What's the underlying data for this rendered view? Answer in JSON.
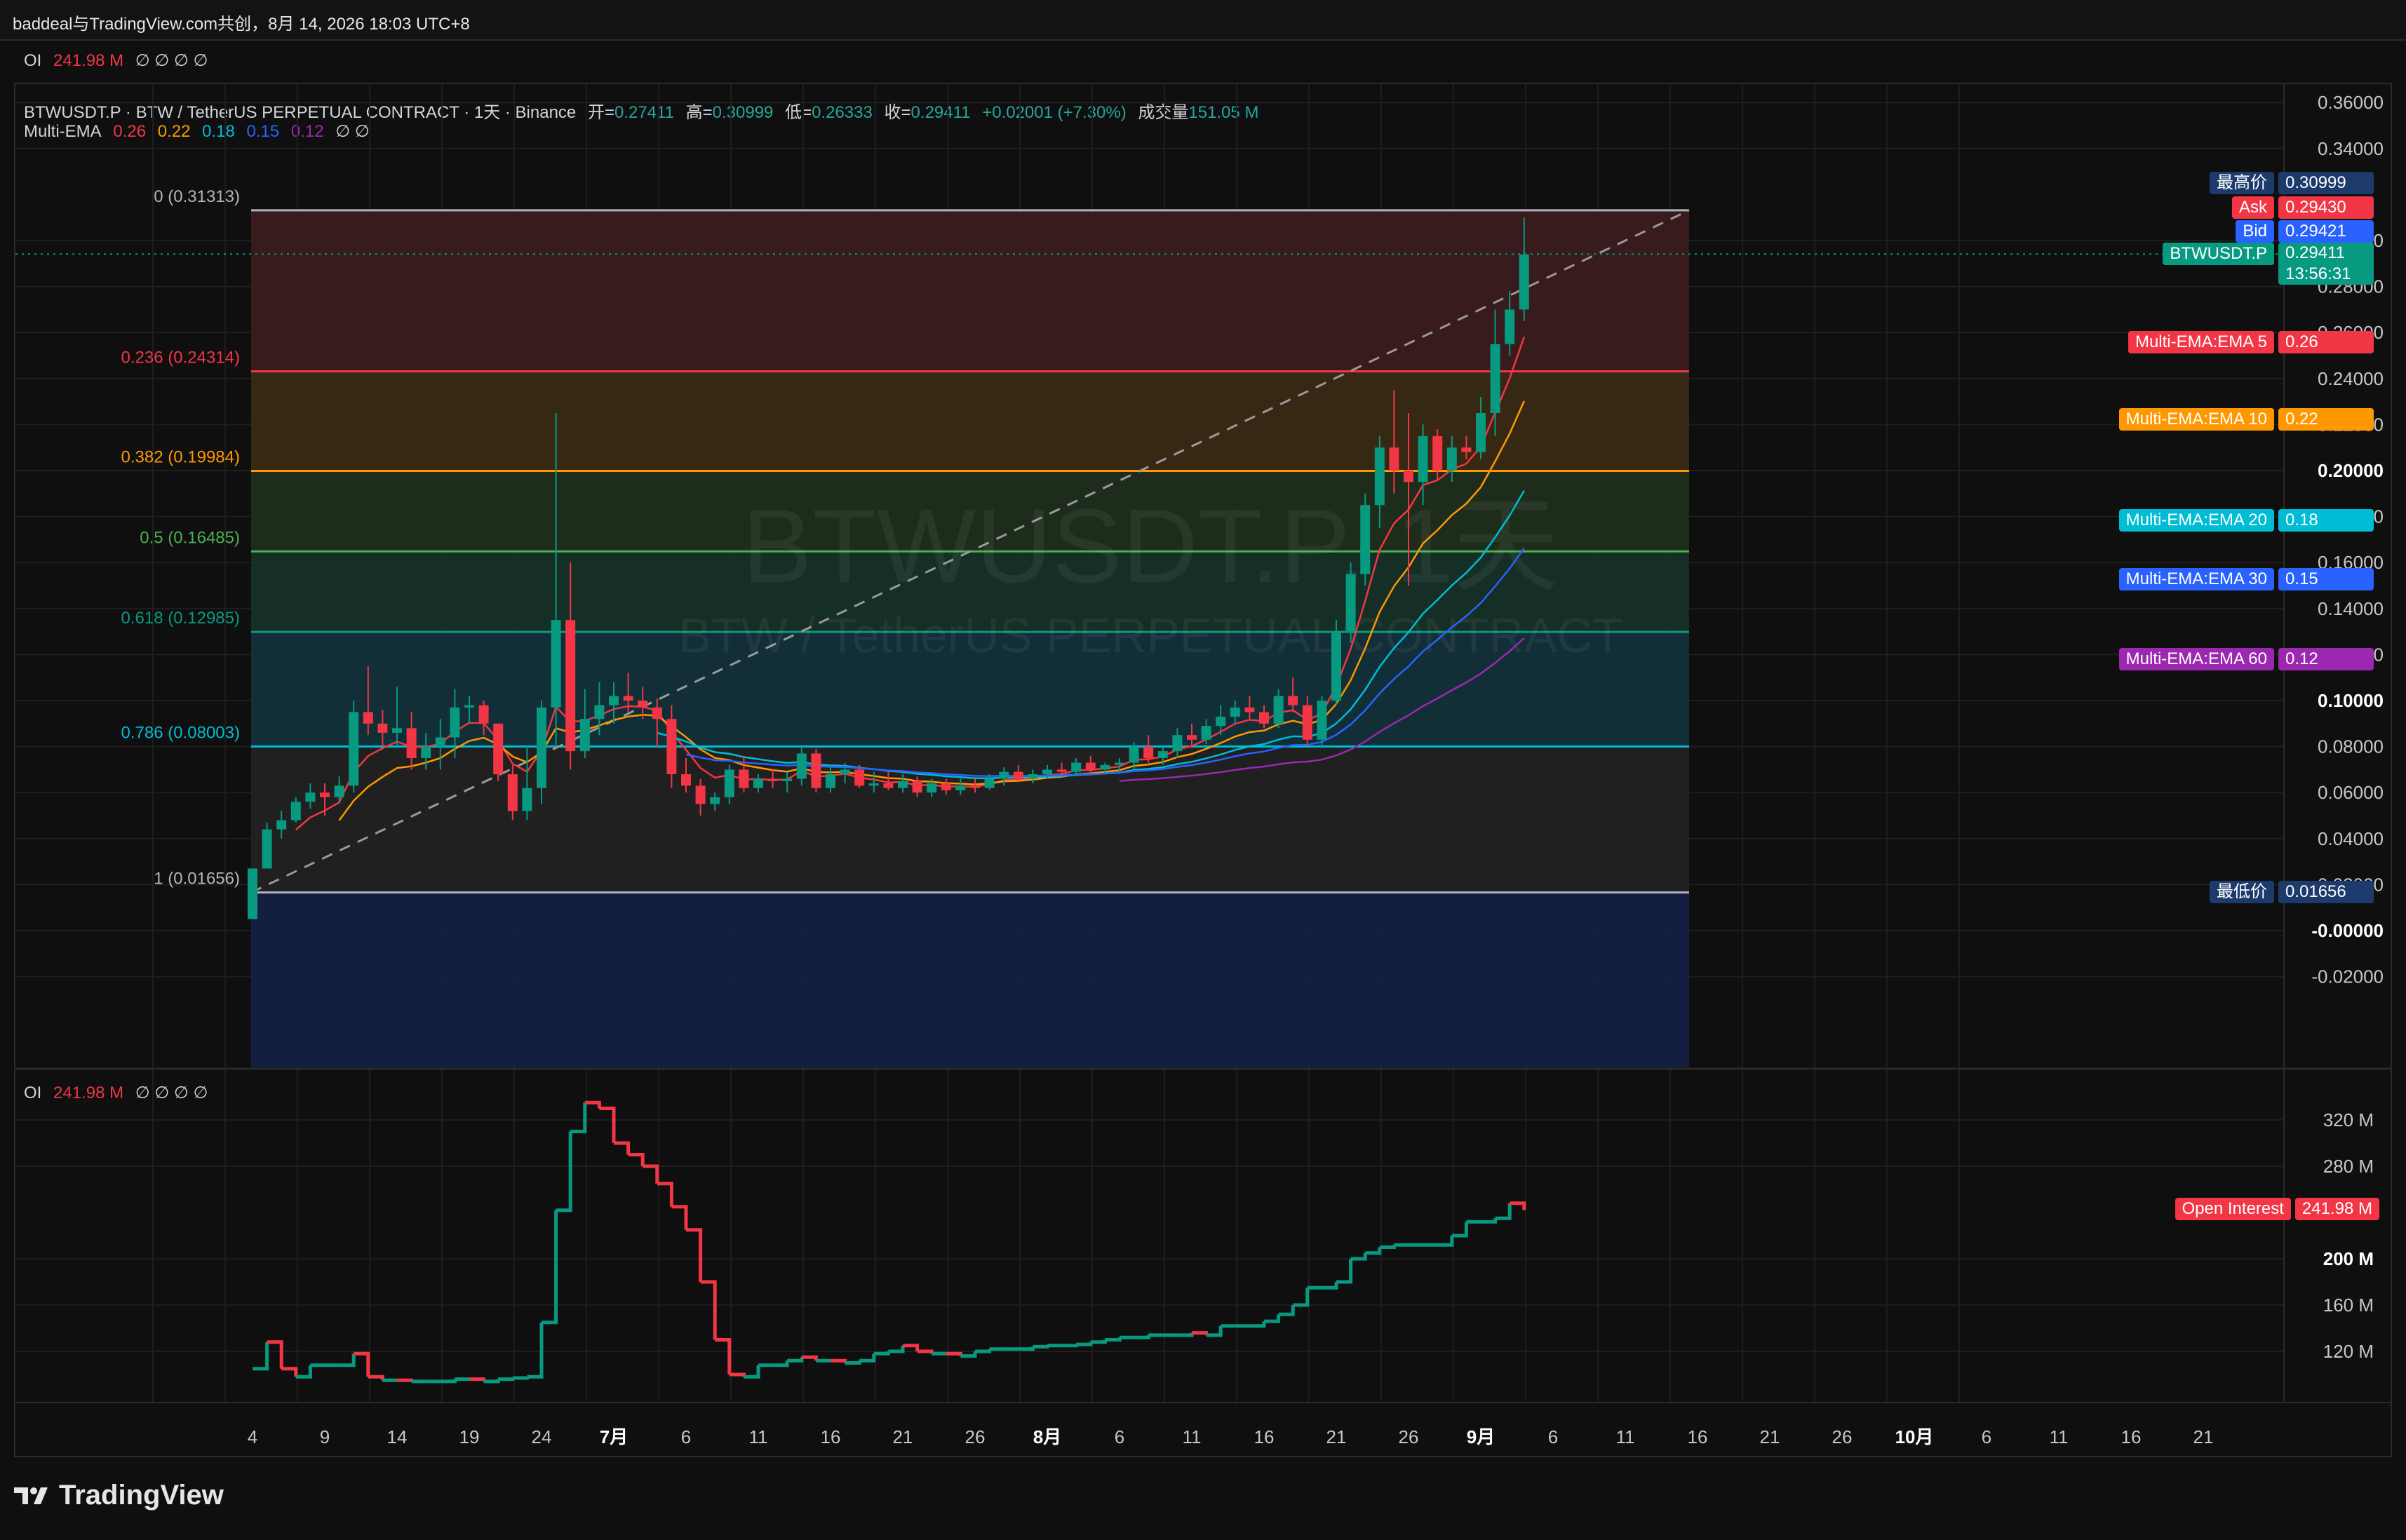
{
  "header": {
    "text": "baddeal与TradingView.com共创，8月 14, 2026 18:03 UTC+8"
  },
  "oi_indicator": {
    "label": "OI",
    "value": "241.98 M",
    "extras": "∅ ∅ ∅ ∅"
  },
  "symbol_legend": {
    "title": "BTWUSDT.P · BTW / TetherUS PERPETUAL CONTRACT · 1天 · Binance",
    "open_label": "开=",
    "open": "0.27411",
    "high_label": "高=",
    "high": "0.30999",
    "low_label": "低=",
    "low": "0.26333",
    "close_label": "收=",
    "close": "0.29411",
    "change": "+0.02001 (+7.30%)",
    "volume_label": "成交量",
    "volume": "151.05 M"
  },
  "ema_legend": {
    "label": "Multi-EMA",
    "values": [
      "0.26",
      "0.22",
      "0.18",
      "0.15",
      "0.12"
    ],
    "colors": [
      "#f23645",
      "#ff9800",
      "#00bcd4",
      "#2962ff",
      "#9c27b0"
    ],
    "extras": "∅ ∅"
  },
  "watermark": {
    "symbol": "BTWUSDT.P, 1天",
    "name": "BTW / TetherUS PERPETUAL CONTRACT"
  },
  "fib_levels": [
    {
      "level": "0 (0.31313)",
      "price": 0.31313,
      "color": "#b2b5be",
      "fill": "#3a1c1f"
    },
    {
      "level": "0.236 (0.24314)",
      "price": 0.24314,
      "color": "#f23645",
      "fill": "#3a2a14"
    },
    {
      "level": "0.382 (0.19984)",
      "price": 0.19984,
      "color": "#ff9800",
      "fill": "#1f2e1c"
    },
    {
      "level": "0.5 (0.16485)",
      "price": 0.16485,
      "color": "#4caf50",
      "fill": "#163028"
    },
    {
      "level": "0.618 (0.12985)",
      "price": 0.12985,
      "color": "#089981",
      "fill": "#13303a"
    },
    {
      "level": "0.786 (0.08003)",
      "price": 0.08003,
      "color": "#00bcd4",
      "fill": "#222222"
    },
    {
      "level": "1 (0.01656)",
      "price": 0.01656,
      "color": "#b2b5be",
      "fill": "#152044"
    }
  ],
  "price_axis": {
    "ticks": [
      "0.36000",
      "0.34000",
      "0.30000",
      "0.28000",
      "0.26000",
      "0.24000",
      "0.22000",
      "0.20000",
      "0.18000",
      "0.16000",
      "0.14000",
      "0.12000",
      "0.10000",
      "0.08000",
      "0.06000",
      "0.04000",
      "0.02000",
      "-0.00000",
      "-0.02000"
    ],
    "bold_ticks": [
      "0.20000",
      "0.10000",
      "-0.00000"
    ]
  },
  "price_tags": [
    {
      "label": "最高价",
      "value": "0.30999",
      "color": "#1c3a6b"
    },
    {
      "label": "Ask",
      "value": "0.29430",
      "color": "#f23645"
    },
    {
      "label": "Bid",
      "value": "0.29421",
      "color": "#2962ff"
    },
    {
      "label": "BTWUSDT.P",
      "value": "0.29411",
      "sub": "13:56:31",
      "color": "#089981"
    },
    {
      "label": "Multi-EMA:EMA 5",
      "value": "0.26",
      "color": "#f23645"
    },
    {
      "label": "Multi-EMA:EMA 10",
      "value": "0.22",
      "color": "#ff9800"
    },
    {
      "label": "Multi-EMA:EMA 20",
      "value": "0.18",
      "color": "#00bcd4"
    },
    {
      "label": "Multi-EMA:EMA 30",
      "value": "0.15",
      "color": "#2962ff"
    },
    {
      "label": "Multi-EMA:EMA 60",
      "value": "0.12",
      "color": "#9c27b0"
    },
    {
      "label": "最低价",
      "value": "0.01656",
      "color": "#1c3a6b"
    }
  ],
  "oi_axis": {
    "ticks": [
      "320 M",
      "280 M",
      "200 M",
      "160 M",
      "120 M"
    ],
    "bold_ticks": [
      "200 M"
    ]
  },
  "oi_tag": {
    "label": "Open Interest",
    "value": "241.98 M",
    "color": "#f23645"
  },
  "time_axis": {
    "ticks": [
      "4",
      "9",
      "14",
      "19",
      "24",
      "7月",
      "6",
      "11",
      "16",
      "21",
      "26",
      "8月",
      "6",
      "11",
      "16",
      "21",
      "26",
      "9月",
      "6",
      "11",
      "16",
      "21",
      "26",
      "10月",
      "6",
      "11",
      "16",
      "21"
    ],
    "bold_ticks": [
      "7月",
      "8月",
      "9月",
      "10月"
    ]
  },
  "chart_data": {
    "type": "candlestick",
    "title": "BTWUSDT.P · BTW / TetherUS PERPETUAL CONTRACT · 1天 · Binance",
    "ylim": [
      -0.03,
      0.37
    ],
    "x_range_days": [
      0,
      202
    ],
    "candles": [
      [
        0,
        0.005,
        0.027,
        0.005,
        0.027
      ],
      [
        1,
        0.027,
        0.047,
        0.027,
        0.044
      ],
      [
        2,
        0.044,
        0.052,
        0.04,
        0.048
      ],
      [
        3,
        0.048,
        0.058,
        0.047,
        0.056
      ],
      [
        4,
        0.056,
        0.064,
        0.053,
        0.06
      ],
      [
        5,
        0.06,
        0.064,
        0.05,
        0.058
      ],
      [
        6,
        0.058,
        0.067,
        0.056,
        0.063
      ],
      [
        7,
        0.063,
        0.1,
        0.06,
        0.095
      ],
      [
        8,
        0.095,
        0.115,
        0.085,
        0.09
      ],
      [
        9,
        0.09,
        0.096,
        0.08,
        0.086
      ],
      [
        10,
        0.086,
        0.106,
        0.08,
        0.088
      ],
      [
        11,
        0.088,
        0.095,
        0.07,
        0.075
      ],
      [
        12,
        0.075,
        0.086,
        0.07,
        0.08
      ],
      [
        13,
        0.08,
        0.092,
        0.07,
        0.084
      ],
      [
        14,
        0.084,
        0.105,
        0.075,
        0.097
      ],
      [
        15,
        0.097,
        0.102,
        0.09,
        0.098
      ],
      [
        16,
        0.098,
        0.1,
        0.085,
        0.09
      ],
      [
        17,
        0.09,
        0.09,
        0.065,
        0.068
      ],
      [
        18,
        0.068,
        0.072,
        0.048,
        0.052
      ],
      [
        19,
        0.052,
        0.08,
        0.048,
        0.062
      ],
      [
        20,
        0.062,
        0.1,
        0.055,
        0.097
      ],
      [
        21,
        0.097,
        0.225,
        0.08,
        0.135
      ],
      [
        22,
        0.135,
        0.16,
        0.07,
        0.078
      ],
      [
        23,
        0.078,
        0.105,
        0.075,
        0.092
      ],
      [
        24,
        0.092,
        0.108,
        0.085,
        0.098
      ],
      [
        25,
        0.098,
        0.108,
        0.09,
        0.102
      ],
      [
        26,
        0.102,
        0.112,
        0.095,
        0.1
      ],
      [
        27,
        0.1,
        0.106,
        0.092,
        0.097
      ],
      [
        28,
        0.097,
        0.101,
        0.08,
        0.092
      ],
      [
        29,
        0.092,
        0.098,
        0.062,
        0.068
      ],
      [
        30,
        0.068,
        0.075,
        0.06,
        0.063
      ],
      [
        31,
        0.063,
        0.066,
        0.05,
        0.055
      ],
      [
        32,
        0.055,
        0.06,
        0.052,
        0.058
      ],
      [
        33,
        0.058,
        0.072,
        0.055,
        0.07
      ],
      [
        34,
        0.07,
        0.076,
        0.06,
        0.062
      ],
      [
        35,
        0.062,
        0.068,
        0.06,
        0.066
      ],
      [
        36,
        0.066,
        0.07,
        0.062,
        0.065
      ],
      [
        37,
        0.065,
        0.069,
        0.06,
        0.066
      ],
      [
        38,
        0.066,
        0.08,
        0.063,
        0.077
      ],
      [
        39,
        0.077,
        0.079,
        0.06,
        0.062
      ],
      [
        40,
        0.062,
        0.072,
        0.06,
        0.068
      ],
      [
        41,
        0.068,
        0.073,
        0.064,
        0.07
      ],
      [
        42,
        0.07,
        0.072,
        0.062,
        0.063
      ],
      [
        43,
        0.063,
        0.069,
        0.06,
        0.064
      ],
      [
        44,
        0.064,
        0.069,
        0.061,
        0.062
      ],
      [
        45,
        0.062,
        0.068,
        0.06,
        0.065
      ],
      [
        46,
        0.065,
        0.067,
        0.058,
        0.06
      ],
      [
        47,
        0.06,
        0.066,
        0.058,
        0.064
      ],
      [
        48,
        0.064,
        0.066,
        0.059,
        0.061
      ],
      [
        49,
        0.061,
        0.066,
        0.059,
        0.063
      ],
      [
        50,
        0.063,
        0.066,
        0.06,
        0.062
      ],
      [
        51,
        0.062,
        0.068,
        0.061,
        0.066
      ],
      [
        52,
        0.066,
        0.071,
        0.063,
        0.069
      ],
      [
        53,
        0.069,
        0.072,
        0.065,
        0.066
      ],
      [
        54,
        0.066,
        0.07,
        0.064,
        0.068
      ],
      [
        55,
        0.068,
        0.072,
        0.066,
        0.07
      ],
      [
        56,
        0.07,
        0.073,
        0.067,
        0.069
      ],
      [
        57,
        0.069,
        0.075,
        0.067,
        0.073
      ],
      [
        58,
        0.073,
        0.076,
        0.068,
        0.07
      ],
      [
        59,
        0.07,
        0.073,
        0.068,
        0.072
      ],
      [
        60,
        0.072,
        0.075,
        0.069,
        0.073
      ],
      [
        61,
        0.073,
        0.082,
        0.07,
        0.08
      ],
      [
        62,
        0.08,
        0.085,
        0.073,
        0.075
      ],
      [
        63,
        0.075,
        0.08,
        0.072,
        0.078
      ],
      [
        64,
        0.078,
        0.088,
        0.075,
        0.085
      ],
      [
        65,
        0.085,
        0.09,
        0.08,
        0.083
      ],
      [
        66,
        0.083,
        0.092,
        0.081,
        0.089
      ],
      [
        67,
        0.089,
        0.098,
        0.085,
        0.093
      ],
      [
        68,
        0.093,
        0.1,
        0.09,
        0.097
      ],
      [
        69,
        0.097,
        0.102,
        0.092,
        0.095
      ],
      [
        70,
        0.095,
        0.098,
        0.088,
        0.09
      ],
      [
        71,
        0.09,
        0.105,
        0.088,
        0.102
      ],
      [
        72,
        0.102,
        0.11,
        0.095,
        0.098
      ],
      [
        73,
        0.098,
        0.102,
        0.08,
        0.083
      ],
      [
        74,
        0.083,
        0.102,
        0.08,
        0.1
      ],
      [
        75,
        0.1,
        0.135,
        0.098,
        0.13
      ],
      [
        76,
        0.13,
        0.16,
        0.125,
        0.155
      ],
      [
        77,
        0.155,
        0.19,
        0.15,
        0.185
      ],
      [
        78,
        0.185,
        0.215,
        0.175,
        0.21
      ],
      [
        79,
        0.21,
        0.235,
        0.19,
        0.2
      ],
      [
        80,
        0.2,
        0.225,
        0.15,
        0.195
      ],
      [
        81,
        0.195,
        0.22,
        0.185,
        0.215
      ],
      [
        82,
        0.215,
        0.218,
        0.196,
        0.2
      ],
      [
        83,
        0.2,
        0.215,
        0.195,
        0.21
      ],
      [
        84,
        0.21,
        0.215,
        0.205,
        0.208
      ],
      [
        85,
        0.208,
        0.232,
        0.205,
        0.225
      ],
      [
        86,
        0.225,
        0.27,
        0.215,
        0.255
      ],
      [
        87,
        0.255,
        0.278,
        0.25,
        0.27
      ],
      [
        88,
        0.27,
        0.31,
        0.265,
        0.294
      ]
    ],
    "ema": [
      {
        "name": "EMA 5",
        "color": "#f23645",
        "start": 3,
        "end_value": 0.26
      },
      {
        "name": "EMA 10",
        "color": "#ff9800",
        "start": 6,
        "end_value": 0.22
      },
      {
        "name": "EMA 20",
        "color": "#00bcd4",
        "start": 28,
        "end_value": 0.18
      },
      {
        "name": "EMA 30",
        "color": "#2962ff",
        "start": 30,
        "end_value": 0.15
      },
      {
        "name": "EMA 60",
        "color": "#9c27b0",
        "start": 60,
        "end_value": 0.12
      }
    ],
    "open_interest": {
      "unit": "M",
      "ylim": [
        100,
        360
      ],
      "values": [
        [
          0,
          105
        ],
        [
          1,
          128
        ],
        [
          2,
          105
        ],
        [
          3,
          98
        ],
        [
          4,
          108
        ],
        [
          5,
          108
        ],
        [
          6,
          108
        ],
        [
          7,
          118
        ],
        [
          8,
          98
        ],
        [
          9,
          95
        ],
        [
          10,
          95
        ],
        [
          11,
          94
        ],
        [
          12,
          94
        ],
        [
          13,
          94
        ],
        [
          14,
          96
        ],
        [
          15,
          96
        ],
        [
          16,
          94
        ],
        [
          17,
          96
        ],
        [
          18,
          97
        ],
        [
          19,
          98
        ],
        [
          20,
          145
        ],
        [
          21,
          242
        ],
        [
          22,
          310
        ],
        [
          23,
          335
        ],
        [
          24,
          330
        ],
        [
          25,
          300
        ],
        [
          26,
          290
        ],
        [
          27,
          280
        ],
        [
          28,
          265
        ],
        [
          29,
          245
        ],
        [
          30,
          225
        ],
        [
          31,
          180
        ],
        [
          32,
          130
        ],
        [
          33,
          100
        ],
        [
          34,
          98
        ],
        [
          35,
          108
        ],
        [
          36,
          108
        ],
        [
          37,
          112
        ],
        [
          38,
          115
        ],
        [
          39,
          112
        ],
        [
          40,
          112
        ],
        [
          41,
          110
        ],
        [
          42,
          112
        ],
        [
          43,
          118
        ],
        [
          44,
          120
        ],
        [
          45,
          125
        ],
        [
          46,
          120
        ],
        [
          47,
          118
        ],
        [
          48,
          118
        ],
        [
          49,
          116
        ],
        [
          50,
          120
        ],
        [
          51,
          122
        ],
        [
          52,
          122
        ],
        [
          53,
          122
        ],
        [
          54,
          124
        ],
        [
          55,
          125
        ],
        [
          56,
          125
        ],
        [
          57,
          126
        ],
        [
          58,
          128
        ],
        [
          59,
          130
        ],
        [
          60,
          132
        ],
        [
          61,
          132
        ],
        [
          62,
          134
        ],
        [
          63,
          134
        ],
        [
          64,
          134
        ],
        [
          65,
          136
        ],
        [
          66,
          134
        ],
        [
          67,
          142
        ],
        [
          68,
          142
        ],
        [
          69,
          142
        ],
        [
          70,
          146
        ],
        [
          71,
          152
        ],
        [
          72,
          160
        ],
        [
          73,
          175
        ],
        [
          74,
          175
        ],
        [
          75,
          180
        ],
        [
          76,
          200
        ],
        [
          77,
          205
        ],
        [
          78,
          210
        ],
        [
          79,
          212
        ],
        [
          80,
          212
        ],
        [
          81,
          212
        ],
        [
          82,
          212
        ],
        [
          83,
          220
        ],
        [
          84,
          232
        ],
        [
          85,
          232
        ],
        [
          86,
          235
        ],
        [
          87,
          248
        ],
        [
          88,
          242
        ]
      ]
    }
  }
}
